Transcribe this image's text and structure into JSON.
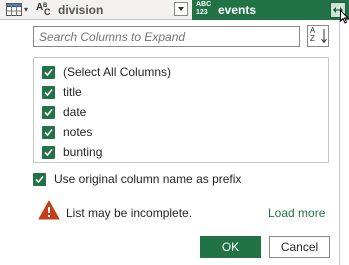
{
  "header": {
    "column1": {
      "name": "division",
      "type_icon": "abc-text-type-icon"
    },
    "column2": {
      "name": "events",
      "type_icon_top": "ABC",
      "type_icon_bottom": "123",
      "expand_icon": "expand-columns-icon"
    },
    "table_icon": "table-icon"
  },
  "dialog": {
    "search": {
      "placeholder": "Search Columns to Expand",
      "value": ""
    },
    "sort_icon": "sort-az-icon",
    "columns": [
      {
        "label": "(Select All Columns)",
        "checked": true
      },
      {
        "label": "title",
        "checked": true
      },
      {
        "label": "date",
        "checked": true
      },
      {
        "label": "notes",
        "checked": true
      },
      {
        "label": "bunting",
        "checked": true
      }
    ],
    "use_prefix": {
      "label": "Use original column name as prefix",
      "checked": true
    },
    "warning": {
      "text": "List may be incomplete.",
      "link": "Load more",
      "icon": "warning-icon"
    },
    "buttons": {
      "ok": "OK",
      "cancel": "Cancel"
    }
  },
  "colors": {
    "accent": "#217346",
    "warning": "#d83b01"
  }
}
